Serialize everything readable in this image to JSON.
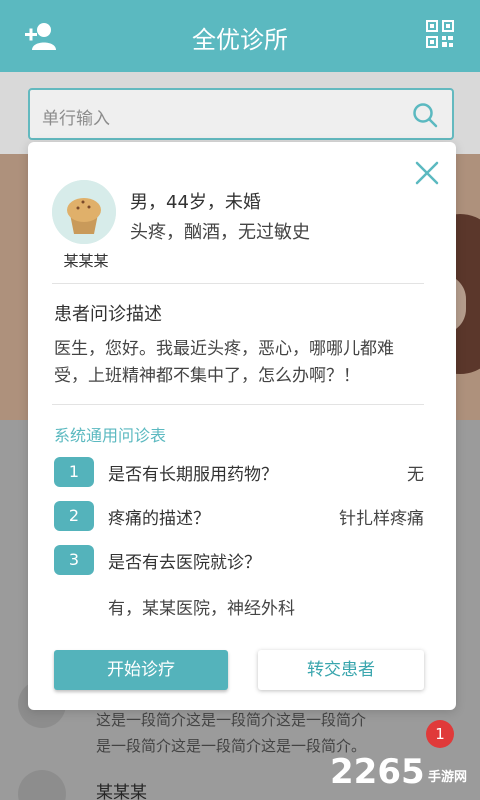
{
  "header": {
    "title": "全优诊所",
    "add_icon": "add-user-icon",
    "qr_icon": "qr-code-icon"
  },
  "search": {
    "placeholder": "单行输入",
    "icon": "search-icon"
  },
  "background": {
    "intro_line1": "这是一段简介这是一段简介这是一段简介",
    "intro_line2": "是一段简介这是一段简介这是一段简介。",
    "name": "某某某",
    "badge_count": "1",
    "watermark": "2265",
    "watermark_sub": "手游网"
  },
  "modal": {
    "close_icon": "close-icon",
    "patient": {
      "name": "某某某",
      "info": "男，44岁，未婚",
      "conditions": "头疼，酗酒，无过敏史"
    },
    "description": {
      "title": "患者问诊描述",
      "text": "医生，您好。我最近头疼，恶心，哪哪儿都难受，上班精神都不集中了，怎么办啊？！"
    },
    "questionnaire": {
      "title": "系统通用问诊表",
      "items": [
        {
          "num": "1",
          "question": "是否有长期服用药物？",
          "answer": "无"
        },
        {
          "num": "2",
          "question": "疼痛的描述？",
          "answer": "针扎样疼痛"
        },
        {
          "num": "3",
          "question": "是否有去医院就诊？",
          "answer": "有，某某医院，神经外科"
        }
      ]
    },
    "buttons": {
      "start": "开始诊疗",
      "transfer": "转交患者"
    }
  },
  "colors": {
    "accent": "#5bb9c0",
    "badge": "#e03a3a"
  }
}
